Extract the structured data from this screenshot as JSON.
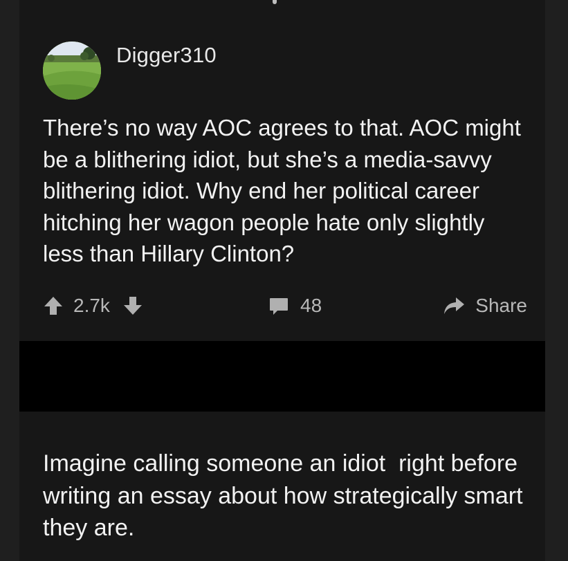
{
  "post": {
    "username": "Digger310",
    "avatar_icon": "golf-course-avatar",
    "body": "There’s no way AOC agrees to that. AOC might be a blithering idiot, but she’s a media-savvy blithering idiot. Why end her political career hitching her wagon people hate only slightly less than Hillary Clinton?",
    "actions": {
      "upvote_icon": "upvote-arrow-icon",
      "score": "2.7k",
      "downvote_icon": "downvote-arrow-icon",
      "comment_icon": "comment-bubble-icon",
      "comment_count": "48",
      "share_icon": "share-arrow-icon",
      "share_label": "Share"
    }
  },
  "reply": {
    "body": "Imagine calling someone an idiot  right before writing an essay about how strategically smart they are."
  },
  "colors": {
    "background": "#171717",
    "text": "#f2f2f2",
    "muted": "#b8b8b8",
    "separator": "#000000"
  }
}
